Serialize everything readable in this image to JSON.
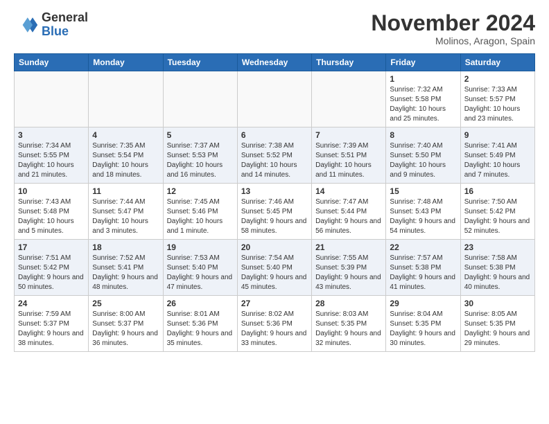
{
  "header": {
    "logo_general": "General",
    "logo_blue": "Blue",
    "month_title": "November 2024",
    "location": "Molinos, Aragon, Spain"
  },
  "weekdays": [
    "Sunday",
    "Monday",
    "Tuesday",
    "Wednesday",
    "Thursday",
    "Friday",
    "Saturday"
  ],
  "weeks": [
    [
      {
        "day": "",
        "info": ""
      },
      {
        "day": "",
        "info": ""
      },
      {
        "day": "",
        "info": ""
      },
      {
        "day": "",
        "info": ""
      },
      {
        "day": "",
        "info": ""
      },
      {
        "day": "1",
        "info": "Sunrise: 7:32 AM\nSunset: 5:58 PM\nDaylight: 10 hours and 25 minutes."
      },
      {
        "day": "2",
        "info": "Sunrise: 7:33 AM\nSunset: 5:57 PM\nDaylight: 10 hours and 23 minutes."
      }
    ],
    [
      {
        "day": "3",
        "info": "Sunrise: 7:34 AM\nSunset: 5:55 PM\nDaylight: 10 hours and 21 minutes."
      },
      {
        "day": "4",
        "info": "Sunrise: 7:35 AM\nSunset: 5:54 PM\nDaylight: 10 hours and 18 minutes."
      },
      {
        "day": "5",
        "info": "Sunrise: 7:37 AM\nSunset: 5:53 PM\nDaylight: 10 hours and 16 minutes."
      },
      {
        "day": "6",
        "info": "Sunrise: 7:38 AM\nSunset: 5:52 PM\nDaylight: 10 hours and 14 minutes."
      },
      {
        "day": "7",
        "info": "Sunrise: 7:39 AM\nSunset: 5:51 PM\nDaylight: 10 hours and 11 minutes."
      },
      {
        "day": "8",
        "info": "Sunrise: 7:40 AM\nSunset: 5:50 PM\nDaylight: 10 hours and 9 minutes."
      },
      {
        "day": "9",
        "info": "Sunrise: 7:41 AM\nSunset: 5:49 PM\nDaylight: 10 hours and 7 minutes."
      }
    ],
    [
      {
        "day": "10",
        "info": "Sunrise: 7:43 AM\nSunset: 5:48 PM\nDaylight: 10 hours and 5 minutes."
      },
      {
        "day": "11",
        "info": "Sunrise: 7:44 AM\nSunset: 5:47 PM\nDaylight: 10 hours and 3 minutes."
      },
      {
        "day": "12",
        "info": "Sunrise: 7:45 AM\nSunset: 5:46 PM\nDaylight: 10 hours and 1 minute."
      },
      {
        "day": "13",
        "info": "Sunrise: 7:46 AM\nSunset: 5:45 PM\nDaylight: 9 hours and 58 minutes."
      },
      {
        "day": "14",
        "info": "Sunrise: 7:47 AM\nSunset: 5:44 PM\nDaylight: 9 hours and 56 minutes."
      },
      {
        "day": "15",
        "info": "Sunrise: 7:48 AM\nSunset: 5:43 PM\nDaylight: 9 hours and 54 minutes."
      },
      {
        "day": "16",
        "info": "Sunrise: 7:50 AM\nSunset: 5:42 PM\nDaylight: 9 hours and 52 minutes."
      }
    ],
    [
      {
        "day": "17",
        "info": "Sunrise: 7:51 AM\nSunset: 5:42 PM\nDaylight: 9 hours and 50 minutes."
      },
      {
        "day": "18",
        "info": "Sunrise: 7:52 AM\nSunset: 5:41 PM\nDaylight: 9 hours and 48 minutes."
      },
      {
        "day": "19",
        "info": "Sunrise: 7:53 AM\nSunset: 5:40 PM\nDaylight: 9 hours and 47 minutes."
      },
      {
        "day": "20",
        "info": "Sunrise: 7:54 AM\nSunset: 5:40 PM\nDaylight: 9 hours and 45 minutes."
      },
      {
        "day": "21",
        "info": "Sunrise: 7:55 AM\nSunset: 5:39 PM\nDaylight: 9 hours and 43 minutes."
      },
      {
        "day": "22",
        "info": "Sunrise: 7:57 AM\nSunset: 5:38 PM\nDaylight: 9 hours and 41 minutes."
      },
      {
        "day": "23",
        "info": "Sunrise: 7:58 AM\nSunset: 5:38 PM\nDaylight: 9 hours and 40 minutes."
      }
    ],
    [
      {
        "day": "24",
        "info": "Sunrise: 7:59 AM\nSunset: 5:37 PM\nDaylight: 9 hours and 38 minutes."
      },
      {
        "day": "25",
        "info": "Sunrise: 8:00 AM\nSunset: 5:37 PM\nDaylight: 9 hours and 36 minutes."
      },
      {
        "day": "26",
        "info": "Sunrise: 8:01 AM\nSunset: 5:36 PM\nDaylight: 9 hours and 35 minutes."
      },
      {
        "day": "27",
        "info": "Sunrise: 8:02 AM\nSunset: 5:36 PM\nDaylight: 9 hours and 33 minutes."
      },
      {
        "day": "28",
        "info": "Sunrise: 8:03 AM\nSunset: 5:35 PM\nDaylight: 9 hours and 32 minutes."
      },
      {
        "day": "29",
        "info": "Sunrise: 8:04 AM\nSunset: 5:35 PM\nDaylight: 9 hours and 30 minutes."
      },
      {
        "day": "30",
        "info": "Sunrise: 8:05 AM\nSunset: 5:35 PM\nDaylight: 9 hours and 29 minutes."
      }
    ]
  ]
}
